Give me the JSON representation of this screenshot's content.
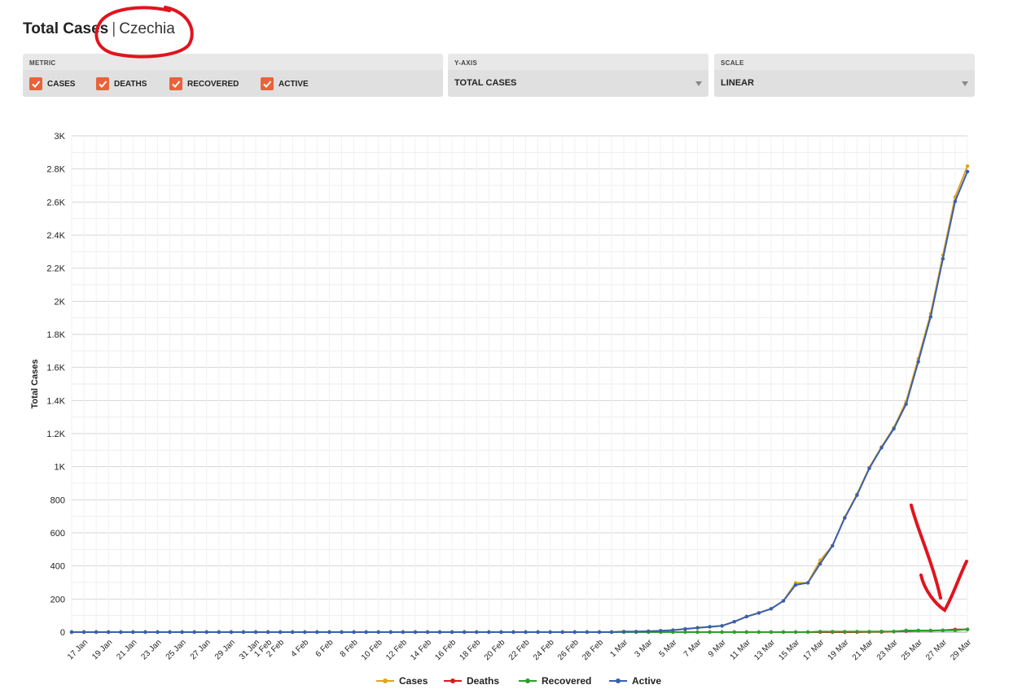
{
  "header": {
    "title_bold": "Total Cases",
    "separator": "|",
    "country": "Czechia"
  },
  "controls": {
    "metric": {
      "label": "METRIC",
      "items": [
        {
          "label": "CASES",
          "checked": true
        },
        {
          "label": "DEATHS",
          "checked": true
        },
        {
          "label": "RECOVERED",
          "checked": true
        },
        {
          "label": "ACTIVE",
          "checked": true
        }
      ]
    },
    "yaxis": {
      "label": "Y-AXIS",
      "value": "TOTAL CASES"
    },
    "scale": {
      "label": "SCALE",
      "value": "LINEAR"
    }
  },
  "colors": {
    "checkbox": "#e8633a",
    "cases": "#e0a41c",
    "deaths": "#d7191c",
    "recovered": "#2ca02c",
    "active": "#3a5fae",
    "annotation": "#e0141e"
  },
  "chart_data": {
    "type": "line",
    "ylabel": "Total Cases",
    "xlabel": "",
    "ylim": [
      0,
      3000
    ],
    "y_ticks": [
      "0",
      "200",
      "400",
      "600",
      "800",
      "1K",
      "1.2K",
      "1.4K",
      "1.6K",
      "1.8K",
      "2K",
      "2.2K",
      "2.4K",
      "2.6K",
      "2.8K",
      "3K"
    ],
    "x_tick_labels": [
      "17 Jan",
      "19 Jan",
      "21 Jan",
      "23 Jan",
      "25 Jan",
      "27 Jan",
      "29 Jan",
      "31 Jan",
      "1 Feb",
      "2 Feb",
      "4 Feb",
      "6 Feb",
      "8 Feb",
      "10 Feb",
      "12 Feb",
      "14 Feb",
      "16 Feb",
      "18 Feb",
      "20 Feb",
      "22 Feb",
      "24 Feb",
      "26 Feb",
      "28 Feb",
      "1 Mar",
      "3 Mar",
      "5 Mar",
      "7 Mar",
      "9 Mar",
      "11 Mar",
      "13 Mar",
      "15 Mar",
      "17 Mar",
      "19 Mar",
      "21 Mar",
      "23 Mar",
      "25 Mar",
      "27 Mar",
      "29 Mar"
    ],
    "grid": true,
    "legend_position": "bottom-center",
    "x": [
      "16 Jan",
      "17 Jan",
      "18 Jan",
      "19 Jan",
      "20 Jan",
      "21 Jan",
      "22 Jan",
      "23 Jan",
      "24 Jan",
      "25 Jan",
      "26 Jan",
      "27 Jan",
      "28 Jan",
      "29 Jan",
      "30 Jan",
      "31 Jan",
      "1 Feb",
      "2 Feb",
      "3 Feb",
      "4 Feb",
      "5 Feb",
      "6 Feb",
      "7 Feb",
      "8 Feb",
      "9 Feb",
      "10 Feb",
      "11 Feb",
      "12 Feb",
      "13 Feb",
      "14 Feb",
      "15 Feb",
      "16 Feb",
      "17 Feb",
      "18 Feb",
      "19 Feb",
      "20 Feb",
      "21 Feb",
      "22 Feb",
      "23 Feb",
      "24 Feb",
      "25 Feb",
      "26 Feb",
      "27 Feb",
      "28 Feb",
      "29 Feb",
      "1 Mar",
      "2 Mar",
      "3 Mar",
      "4 Mar",
      "5 Mar",
      "6 Mar",
      "7 Mar",
      "8 Mar",
      "9 Mar",
      "10 Mar",
      "11 Mar",
      "12 Mar",
      "13 Mar",
      "14 Mar",
      "15 Mar",
      "16 Mar",
      "17 Mar",
      "18 Mar",
      "19 Mar",
      "20 Mar",
      "21 Mar",
      "22 Mar",
      "23 Mar",
      "24 Mar",
      "25 Mar",
      "26 Mar",
      "27 Mar",
      "28 Mar",
      "29 Mar"
    ],
    "series": [
      {
        "name": "Cases",
        "values": [
          0,
          0,
          0,
          0,
          0,
          0,
          0,
          0,
          0,
          0,
          0,
          0,
          0,
          0,
          0,
          0,
          0,
          0,
          0,
          0,
          0,
          0,
          0,
          0,
          0,
          0,
          0,
          0,
          0,
          0,
          0,
          0,
          0,
          0,
          0,
          0,
          0,
          0,
          0,
          0,
          0,
          0,
          0,
          0,
          0,
          3,
          3,
          5,
          8,
          12,
          19,
          26,
          32,
          38,
          63,
          94,
          116,
          141,
          189,
          298,
          298,
          434,
          522,
          694,
          833,
          995,
          1120,
          1236,
          1394,
          1654,
          1925,
          2279,
          2631,
          2817
        ]
      },
      {
        "name": "Deaths",
        "values": [
          0,
          0,
          0,
          0,
          0,
          0,
          0,
          0,
          0,
          0,
          0,
          0,
          0,
          0,
          0,
          0,
          0,
          0,
          0,
          0,
          0,
          0,
          0,
          0,
          0,
          0,
          0,
          0,
          0,
          0,
          0,
          0,
          0,
          0,
          0,
          0,
          0,
          0,
          0,
          0,
          0,
          0,
          0,
          0,
          0,
          0,
          0,
          0,
          0,
          0,
          0,
          0,
          0,
          0,
          0,
          0,
          0,
          0,
          0,
          0,
          0,
          0,
          0,
          0,
          0,
          1,
          1,
          3,
          6,
          9,
          9,
          11,
          16,
          16
        ]
      },
      {
        "name": "Recovered",
        "values": [
          0,
          0,
          0,
          0,
          0,
          0,
          0,
          0,
          0,
          0,
          0,
          0,
          0,
          0,
          0,
          0,
          0,
          0,
          0,
          0,
          0,
          0,
          0,
          0,
          0,
          0,
          0,
          0,
          0,
          0,
          0,
          0,
          0,
          0,
          0,
          0,
          0,
          0,
          0,
          0,
          0,
          0,
          0,
          0,
          0,
          0,
          0,
          0,
          0,
          0,
          0,
          0,
          0,
          0,
          0,
          0,
          0,
          0,
          0,
          0,
          0,
          3,
          3,
          3,
          3,
          3,
          4,
          4,
          10,
          10,
          10,
          11,
          11,
          17
        ]
      },
      {
        "name": "Active",
        "values": [
          0,
          0,
          0,
          0,
          0,
          0,
          0,
          0,
          0,
          0,
          0,
          0,
          0,
          0,
          0,
          0,
          0,
          0,
          0,
          0,
          0,
          0,
          0,
          0,
          0,
          0,
          0,
          0,
          0,
          0,
          0,
          0,
          0,
          0,
          0,
          0,
          0,
          0,
          0,
          0,
          0,
          0,
          0,
          0,
          0,
          3,
          3,
          5,
          8,
          12,
          19,
          26,
          32,
          38,
          63,
          94,
          116,
          141,
          189,
          285,
          298,
          413,
          522,
          690,
          828,
          990,
          1115,
          1229,
          1378,
          1635,
          1906,
          2257,
          2604,
          2784
        ]
      }
    ]
  }
}
